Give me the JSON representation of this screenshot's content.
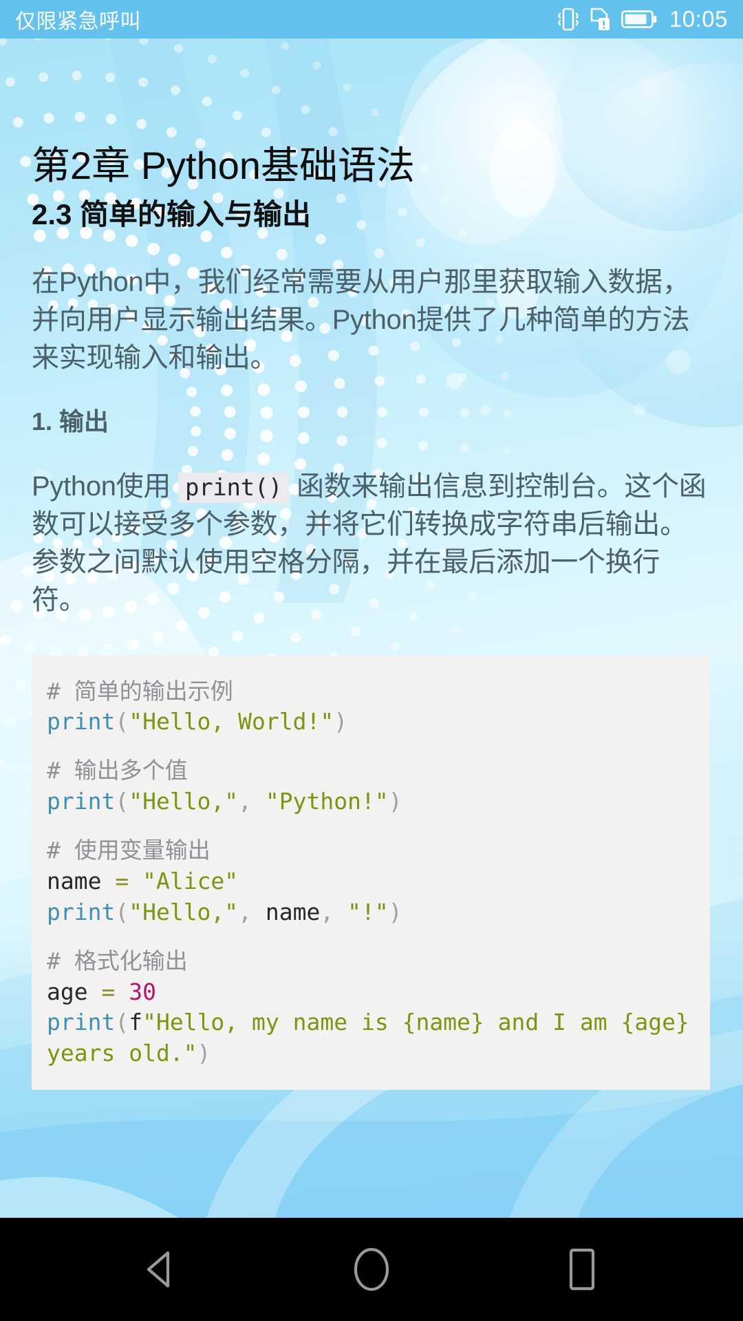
{
  "status_bar": {
    "carrier": "仅限紧急呼叫",
    "time": "10:05",
    "icons": [
      "vibrate-icon",
      "sim-alert-icon",
      "battery-icon"
    ],
    "background_color": "#63c1ed",
    "text_color": "#ffffff"
  },
  "document": {
    "chapter_title": "第2章 Python基础语法",
    "section_title": "2.3 简单的输入与输出",
    "intro_paragraph": "在Python中，我们经常需要从用户那里获取输入数据，并向用户显示输出结果。Python提供了几种简单的方法来实现输入和输出。",
    "subheading_output": "1. 输出",
    "output_paragraph": {
      "before": "Python使用",
      "inline_code": "print()",
      "after": "函数来输出信息到控制台。这个函数可以接受多个参数，并将它们转换成字符串后输出。参数之间默认使用空格分隔，并在最后添加一个换行符。"
    },
    "code_block": {
      "language": "python",
      "background_color": "#f3f2f0",
      "lines": [
        [
          {
            "t": "comment",
            "s": "# 简单的输出示例"
          }
        ],
        [
          {
            "t": "func",
            "s": "print"
          },
          {
            "t": "punct",
            "s": "("
          },
          {
            "t": "string",
            "s": "\"Hello, World!\""
          },
          {
            "t": "punct",
            "s": ")"
          }
        ],
        [],
        [
          {
            "t": "comment",
            "s": "# 输出多个值"
          }
        ],
        [
          {
            "t": "func",
            "s": "print"
          },
          {
            "t": "punct",
            "s": "("
          },
          {
            "t": "string",
            "s": "\"Hello,\""
          },
          {
            "t": "punct",
            "s": ", "
          },
          {
            "t": "string",
            "s": "\"Python!\""
          },
          {
            "t": "punct",
            "s": ")"
          }
        ],
        [],
        [
          {
            "t": "comment",
            "s": "# 使用变量输出"
          }
        ],
        [
          {
            "t": "name",
            "s": "name"
          },
          {
            "t": "op",
            "s": " = "
          },
          {
            "t": "string",
            "s": "\"Alice\""
          }
        ],
        [
          {
            "t": "func",
            "s": "print"
          },
          {
            "t": "punct",
            "s": "("
          },
          {
            "t": "string",
            "s": "\"Hello,\""
          },
          {
            "t": "punct",
            "s": ", "
          },
          {
            "t": "name",
            "s": "name"
          },
          {
            "t": "punct",
            "s": ", "
          },
          {
            "t": "string",
            "s": "\"!\""
          },
          {
            "t": "punct",
            "s": ")"
          }
        ],
        [],
        [
          {
            "t": "comment",
            "s": "# 格式化输出"
          }
        ],
        [
          {
            "t": "name",
            "s": "age"
          },
          {
            "t": "op",
            "s": " = "
          },
          {
            "t": "number",
            "s": "30"
          }
        ],
        [
          {
            "t": "func",
            "s": "print"
          },
          {
            "t": "punct",
            "s": "("
          },
          {
            "t": "prefix",
            "s": "f"
          },
          {
            "t": "string",
            "s": "\"Hello, my name is {name} and I am {age} years old.\""
          },
          {
            "t": "punct",
            "s": ")"
          }
        ]
      ]
    }
  },
  "theme": {
    "accent": "#63c1ed",
    "body_text": "#4c6069",
    "heading_text": "#0c0c0c",
    "code_bg": "#f3f2f0",
    "inline_code_bg": "#eceaee",
    "comment": "#8d9299",
    "function": "#3d8fb5",
    "string": "#78960f",
    "number": "#b5146c",
    "operator": "#8a8d2a"
  },
  "nav_bar": {
    "background_color": "#000000",
    "buttons": [
      {
        "name": "back-button",
        "icon": "back-triangle-icon"
      },
      {
        "name": "home-button",
        "icon": "home-circle-icon"
      },
      {
        "name": "recents-button",
        "icon": "recents-square-icon"
      }
    ]
  }
}
